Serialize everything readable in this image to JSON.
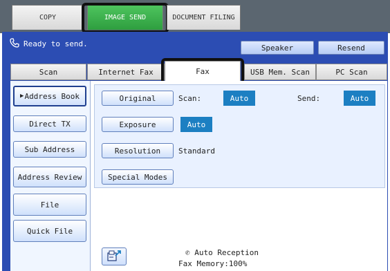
{
  "mode_tabs": {
    "copy": "COPY",
    "image_send": "IMAGE SEND",
    "document_filing": "DOCUMENT FILING"
  },
  "status": {
    "text": "Ready to send."
  },
  "header_buttons": {
    "speaker": "Speaker",
    "resend": "Resend"
  },
  "function_tabs": {
    "scan": "Scan",
    "internet_fax": "Internet Fax",
    "fax": "Fax",
    "usb_mem_scan": "USB Mem. Scan",
    "pc_scan": "PC Scan"
  },
  "sidebar": {
    "address_book": "Address Book",
    "direct_tx": "Direct TX",
    "sub_address": "Sub Address",
    "address_review": "Address Review",
    "file": "File",
    "quick_file": "Quick File"
  },
  "settings": {
    "original_label": "Original",
    "scan_label": "Scan:",
    "scan_value": "Auto",
    "send_label": "Send:",
    "send_value": "Auto",
    "exposure_label": "Exposure",
    "exposure_value": "Auto",
    "resolution_label": "Resolution",
    "resolution_value": "Standard",
    "special_modes_label": "Special Modes"
  },
  "footer": {
    "auto_reception": "Auto Reception",
    "fax_memory": "Fax Memory:100%"
  },
  "colors": {
    "panel_blue": "#2c4db3",
    "active_green": "#2e9e3f",
    "auto_blue": "#1c7fc2"
  }
}
